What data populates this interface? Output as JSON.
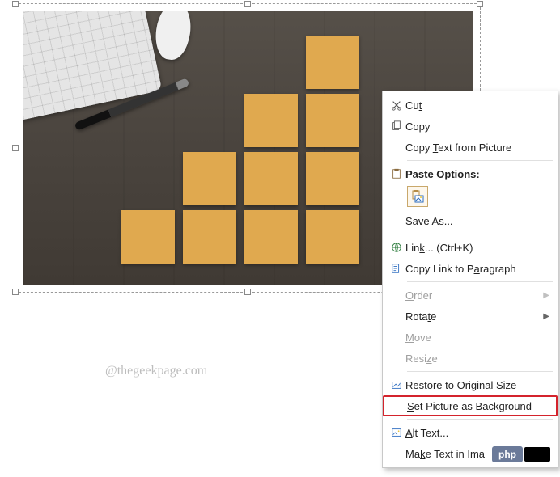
{
  "watermark": "@thegeekpage.com",
  "menu": {
    "cut": "Cut",
    "copy": "Copy",
    "copy_text_from_picture": "Copy Text from Picture",
    "paste_options": "Paste Options:",
    "save_as": "Save As...",
    "link": "Link...  (Ctrl+K)",
    "copy_link_to_paragraph": "Copy Link to Paragraph",
    "order": "Order",
    "rotate": "Rotate",
    "move": "Move",
    "resize": "Resize",
    "restore_original": "Restore to Original Size",
    "set_as_background": "Set Picture as Background",
    "alt_text": "Alt Text...",
    "make_text": "Make Text in Ima"
  },
  "badge": {
    "label": "php"
  }
}
